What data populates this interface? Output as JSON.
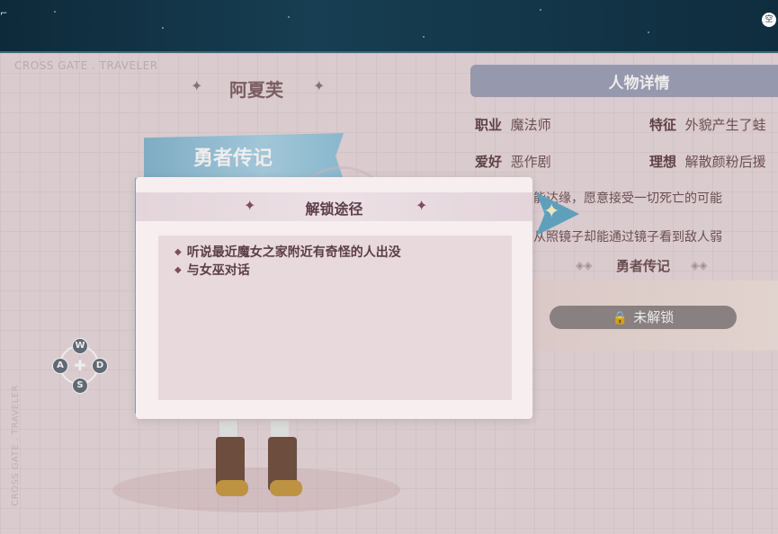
{
  "watermark": "CROSS GATE . TRAVELER",
  "character": {
    "name": "阿夏芙",
    "banner_title": "勇者传记"
  },
  "panel": {
    "title": "人物详情",
    "rows": [
      {
        "label": "职业",
        "value": "魔法师",
        "label2": "特征",
        "value2": "外貌产生了蛙"
      },
      {
        "label": "爱好",
        "value": "恶作剧",
        "label2": "理想",
        "value2": "解散颜粉后援"
      }
    ],
    "desc_lines": [
      "能达缘，愿意接受一切死亡的可能",
      "从照镜子却能通过镜子看到敌人弱"
    ],
    "section_title": "勇者传记",
    "lock_label": "未解锁"
  },
  "modal": {
    "title": "解锁途径",
    "ways": [
      "听说最近魔女之家附近有奇怪的人出没",
      "与女巫对话"
    ]
  },
  "dpad": {
    "up": "W",
    "left": "A",
    "right": "D",
    "down": "S"
  },
  "topbar": {
    "badge": "空"
  },
  "icons": {
    "sparkle": "four-point-star-icon",
    "lock": "lock-icon",
    "dpad": "dpad-icon"
  }
}
